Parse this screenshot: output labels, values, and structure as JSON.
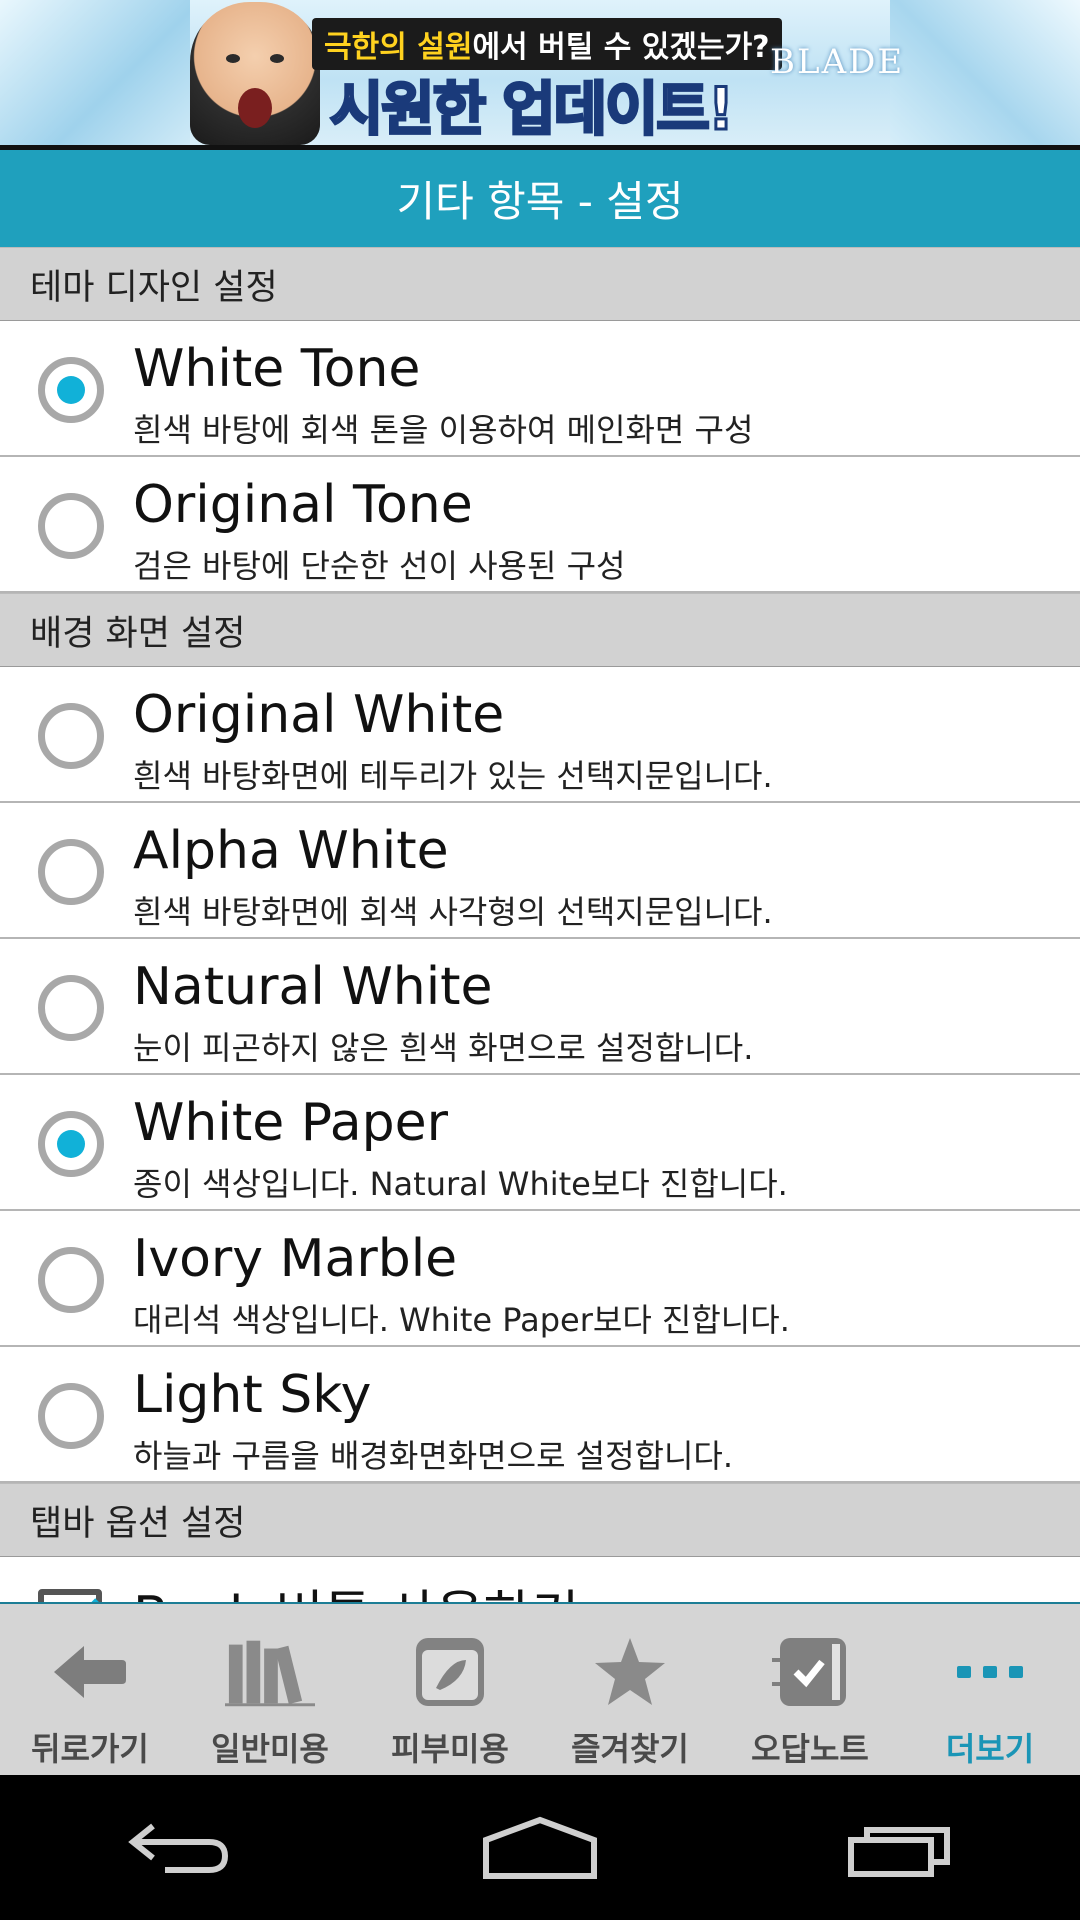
{
  "ad_banner": {
    "headline_highlight": "극한의 설원",
    "headline_rest": "에서 버틸 수 있겠는가?",
    "headline_main": "시원한 업데이트!",
    "brand": "BLADE"
  },
  "header": {
    "title": "기타 항목 - 설정"
  },
  "sections": [
    {
      "title": "테마 디자인 설정",
      "items": [
        {
          "title": "White Tone",
          "description": "흰색 바탕에 회색 톤을 이용하여 메인화면 구성",
          "selected": true
        },
        {
          "title": "Original Tone",
          "description": "검은 바탕에 단순한 선이 사용된 구성",
          "selected": false
        }
      ]
    },
    {
      "title": "배경 화면 설정",
      "items": [
        {
          "title": "Original White",
          "description": "흰색 바탕화면에 테두리가 있는 선택지문입니다.",
          "selected": false
        },
        {
          "title": "Alpha White",
          "description": "흰색 바탕화면에 회색 사각형의 선택지문입니다.",
          "selected": false
        },
        {
          "title": "Natural White",
          "description": "눈이 피곤하지 않은 흰색 화면으로 설정합니다.",
          "selected": false
        },
        {
          "title": "White Paper",
          "description": "종이 색상입니다. Natural White보다 진합니다.",
          "selected": true
        },
        {
          "title": "Ivory Marble",
          "description": "대리석 색상입니다. White Paper보다 진합니다.",
          "selected": false
        },
        {
          "title": "Light Sky",
          "description": "하늘과 구름을 배경화면화면으로 설정합니다.",
          "selected": false
        }
      ]
    },
    {
      "title": "탭바 옵션 설정",
      "items": [
        {
          "title": "Back 버튼 사용하기",
          "checked": true
        }
      ]
    }
  ],
  "tabbar": {
    "active_color": "#1a95b6",
    "tabs": [
      {
        "label": "뒤로가기",
        "icon": "back-arrow-icon"
      },
      {
        "label": "일반미용",
        "icon": "books-icon"
      },
      {
        "label": "피부미용",
        "icon": "notebook-leaf-icon"
      },
      {
        "label": "즐겨찾기",
        "icon": "star-icon"
      },
      {
        "label": "오답노트",
        "icon": "checklist-note-icon"
      },
      {
        "label": "더보기",
        "icon": "more-dots-icon",
        "active": true
      }
    ]
  },
  "system_nav": {
    "buttons": [
      "back-icon",
      "home-icon",
      "recent-apps-icon"
    ]
  },
  "colors": {
    "header_bg": "#1fa0bd",
    "radio_selected": "#11b1d8",
    "section_bg": "#d2d2d2"
  }
}
